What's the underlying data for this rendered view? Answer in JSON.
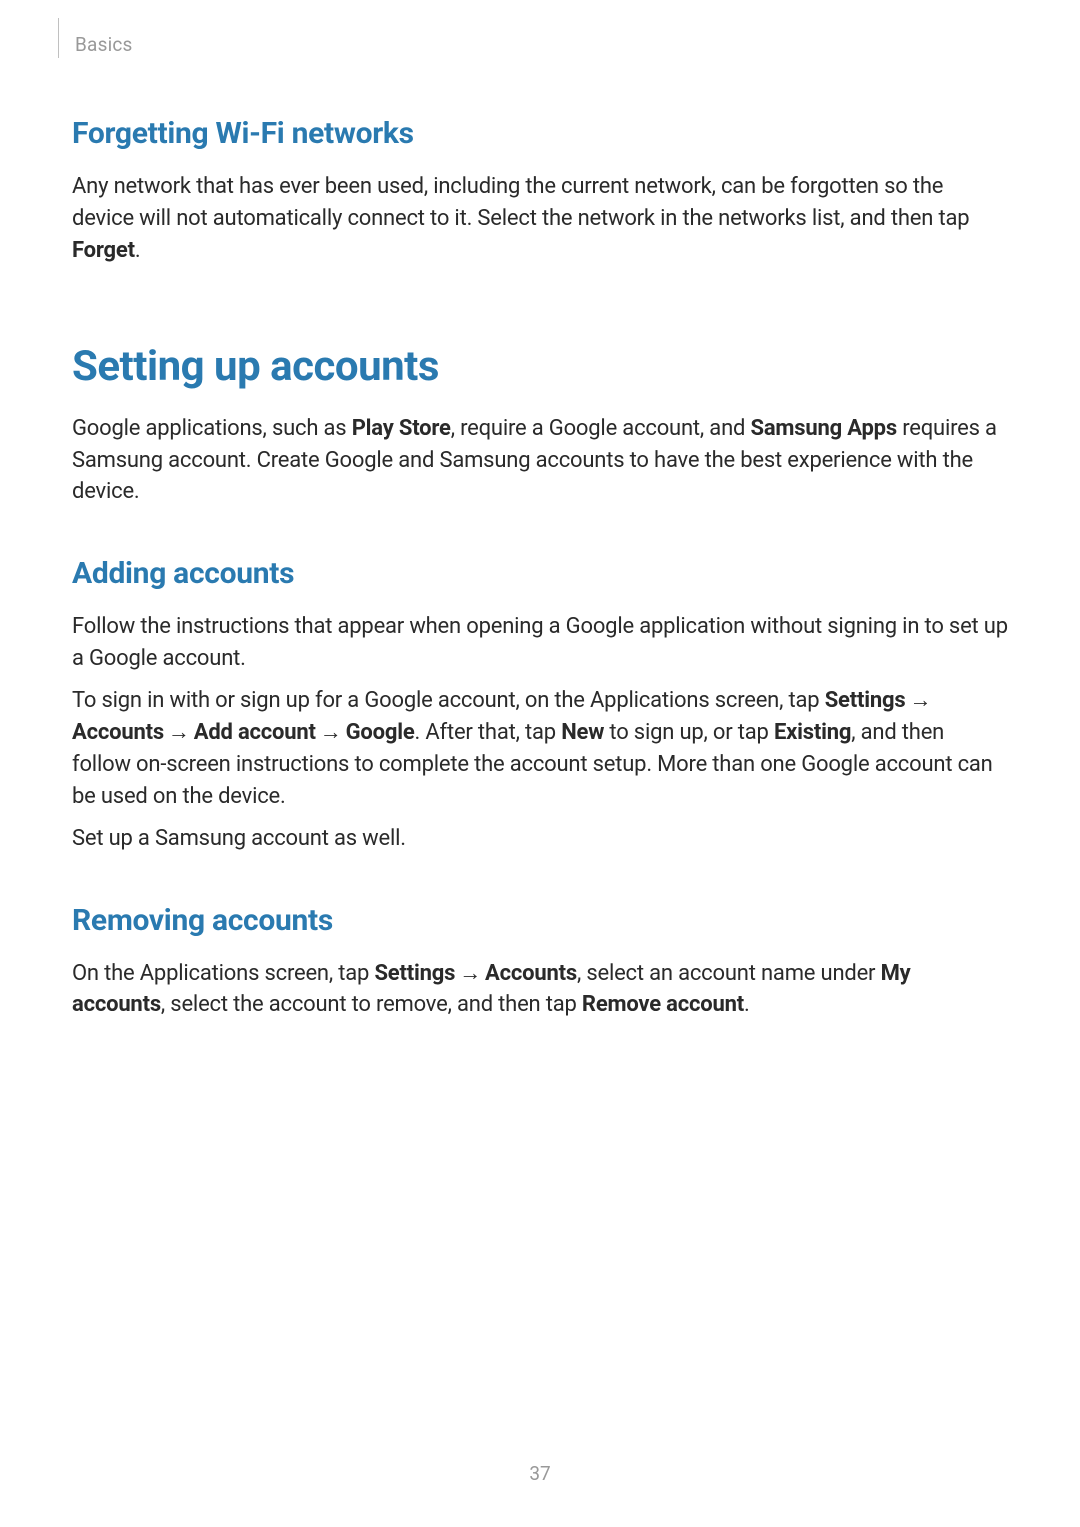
{
  "breadcrumb": "Basics",
  "sections": {
    "forgetting": {
      "heading": "Forgetting Wi-Fi networks",
      "p1_a": "Any network that has ever been used, including the current network, can be forgotten so the device will not automatically connect to it. Select the network in the networks list, and then tap ",
      "p1_bold": "Forget",
      "p1_b": "."
    },
    "setting_up": {
      "heading": "Setting up accounts",
      "p1_a": "Google applications, such as ",
      "p1_bold1": "Play Store",
      "p1_b": ", require a Google account, and ",
      "p1_bold2": "Samsung Apps",
      "p1_c": " requires a Samsung account. Create Google and Samsung accounts to have the best experience with the device."
    },
    "adding": {
      "heading": "Adding accounts",
      "p1": "Follow the instructions that appear when opening a Google application without signing in to set up a Google account.",
      "p2_a": "To sign in with or sign up for a Google account, on the Applications screen, tap ",
      "p2_settings": "Settings",
      "p2_arrow1": " → ",
      "p2_accounts": "Accounts",
      "p2_arrow2": " → ",
      "p2_addaccount": "Add account",
      "p2_arrow3": " → ",
      "p2_google": "Google",
      "p2_b": ". After that, tap ",
      "p2_new": "New",
      "p2_c": " to sign up, or tap ",
      "p2_existing": "Existing",
      "p2_d": ", and then follow on-screen instructions to complete the account setup. More than one Google account can be used on the device.",
      "p3": "Set up a Samsung account as well."
    },
    "removing": {
      "heading": "Removing accounts",
      "p1_a": "On the Applications screen, tap ",
      "p1_settings": "Settings",
      "p1_arrow1": " → ",
      "p1_accounts": "Accounts",
      "p1_b": ", select an account name under ",
      "p1_myaccounts": "My accounts",
      "p1_c": ", select the account to remove, and then tap ",
      "p1_removeaccount": "Remove account",
      "p1_d": "."
    }
  },
  "page_number": "37"
}
